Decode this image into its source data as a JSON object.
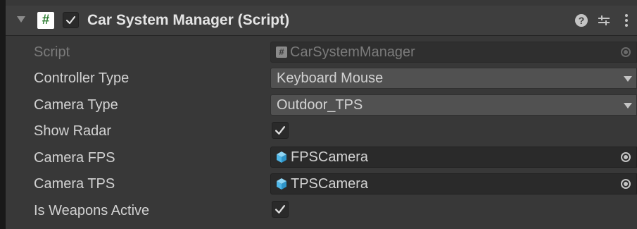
{
  "component": {
    "title": "Car System Manager (Script)",
    "header_icon": "hash-icon",
    "header_icon_glyph": "#",
    "enabled": true,
    "header_actions": [
      "help-icon",
      "preset-icon",
      "more-options-icon"
    ]
  },
  "properties": {
    "script": {
      "label": "Script",
      "value": "CarSystemManager",
      "icon": "script-icon",
      "disabled": true
    },
    "controller_type": {
      "label": "Controller Type",
      "value": "Keyboard Mouse"
    },
    "camera_type": {
      "label": "Camera Type",
      "value": "Outdoor_TPS"
    },
    "show_radar": {
      "label": "Show Radar",
      "checked": true
    },
    "camera_fps": {
      "label": "Camera FPS",
      "value": "FPSCamera",
      "icon": "prefab-cube-icon"
    },
    "camera_tps": {
      "label": "Camera TPS",
      "value": "TPSCamera",
      "icon": "prefab-cube-icon"
    },
    "is_weapons_active": {
      "label": "Is Weapons Active",
      "checked": true
    }
  },
  "colors": {
    "background": "#383838",
    "header": "#3e3e3e",
    "field": "#2a2a2a",
    "popup": "#515151",
    "text": "#d2d2d2",
    "disabled_text": "#7b7b7b",
    "hash_icon": "#2e7d32",
    "prefab_icon": "#4fb7e8"
  }
}
